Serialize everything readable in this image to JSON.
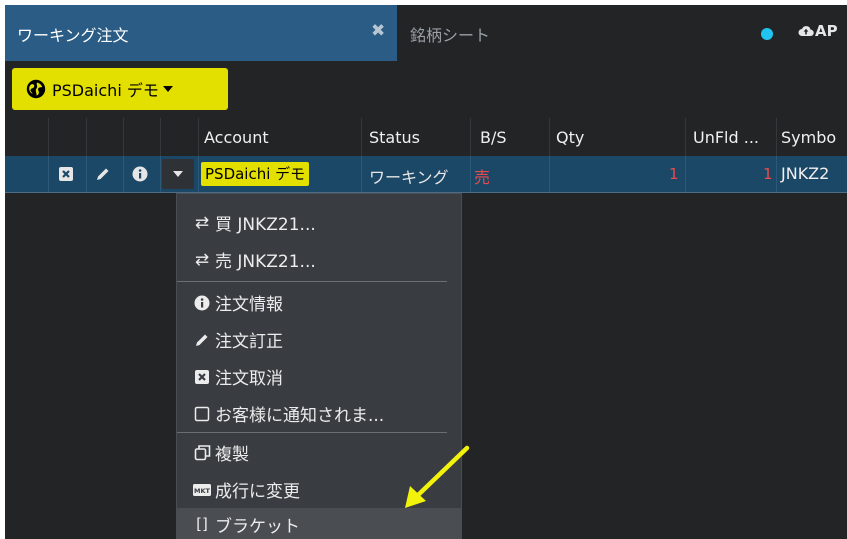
{
  "tabs": {
    "active": {
      "title": "ワーキング注文",
      "close_icon": "close-icon"
    },
    "inactive": {
      "title": "銘柄シート"
    },
    "status_color": "#21c4f0",
    "cloud_label": "AP"
  },
  "account_selector": {
    "label": "PSDaichi デモ",
    "icon": "globe-icon"
  },
  "columns": [
    "Account",
    "Status",
    "B/S",
    "Qty",
    "UnFld ...",
    "Symbo"
  ],
  "row": {
    "account": "PSDaichi デモ",
    "status": "ワーキング",
    "bs": "売",
    "qty": "1",
    "unfilled": "1",
    "symbol": "JNKZ2"
  },
  "menu": {
    "items": [
      {
        "label": "買 JNKZ21...",
        "icon": "swap-icon"
      },
      {
        "label": "売 JNKZ21...",
        "icon": "swap-icon"
      },
      {
        "label": "注文情報",
        "icon": "info-icon"
      },
      {
        "label": "注文訂正",
        "icon": "pencil-icon"
      },
      {
        "label": "注文取消",
        "icon": "cancel-box-icon"
      },
      {
        "label": "お客様に通知されま...",
        "icon": "checkbox-icon"
      },
      {
        "label": "複製",
        "icon": "duplicate-icon"
      },
      {
        "label": "成行に変更",
        "icon": "mkt-icon"
      },
      {
        "label": "ブラケット",
        "icon": "bracket-icon"
      }
    ]
  },
  "colors": {
    "accent": "#e3e000",
    "tab_active": "#2b5c85",
    "sell": "#e84b4b",
    "annotation_arrow": "#f2f20a"
  }
}
